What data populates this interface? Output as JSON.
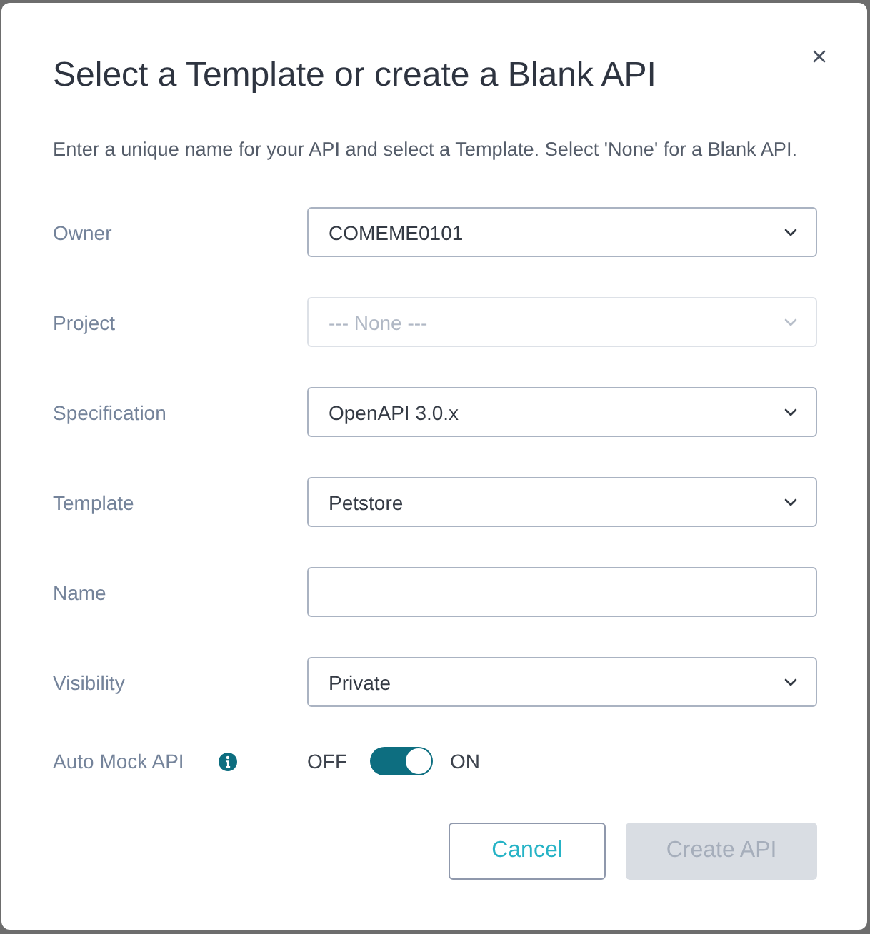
{
  "dialog": {
    "title": "Select a Template or create a Blank API",
    "description": "Enter a unique name for your API and select a Template. Select 'None' for a Blank API."
  },
  "fields": [
    {
      "label": "Owner",
      "kind": "select",
      "value": "COMEME0101",
      "disabled": false
    },
    {
      "label": "Project",
      "kind": "select",
      "value": "--- None ---",
      "disabled": true
    },
    {
      "label": "Specification",
      "kind": "select",
      "value": "OpenAPI 3.0.x",
      "disabled": false
    },
    {
      "label": "Template",
      "kind": "select",
      "value": "Petstore",
      "disabled": false
    },
    {
      "label": "Name",
      "kind": "input",
      "disabled": false
    },
    {
      "label": "Visibility",
      "kind": "select",
      "value": "Private",
      "disabled": false
    }
  ],
  "toggle": {
    "label": "Auto Mock API",
    "off_label": "OFF",
    "on_label": "ON",
    "on": true
  },
  "buttons": [
    {
      "label": "Cancel",
      "kind": "secondary",
      "disabled": false
    },
    {
      "label": "Create API",
      "kind": "primary",
      "disabled": true
    }
  ]
}
